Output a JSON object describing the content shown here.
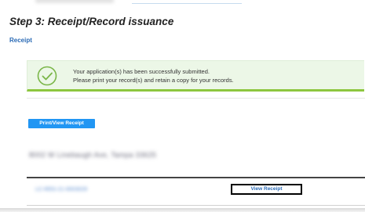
{
  "step": {
    "heading": "Step 3: Receipt/Record issuance",
    "section_label": "Receipt"
  },
  "alert": {
    "icon": "checkmark-circle-icon",
    "line1": "Your application(s) has been successfully submitted.",
    "line2": "Please print your record(s) and retain a copy for your records.",
    "accent_color": "#8dc63f",
    "background_color": "#ecf7e7"
  },
  "actions": {
    "print_label": "Print/View Receipt",
    "button_color": "#2196f3"
  },
  "record": {
    "address_blurred": "8002 W Linebaugh Ave, Tampa 33625",
    "record_number_blurred": "LC-REG-21-0003029",
    "view_receipt_label": "View Receipt",
    "link_color": "#2a6ab5"
  }
}
